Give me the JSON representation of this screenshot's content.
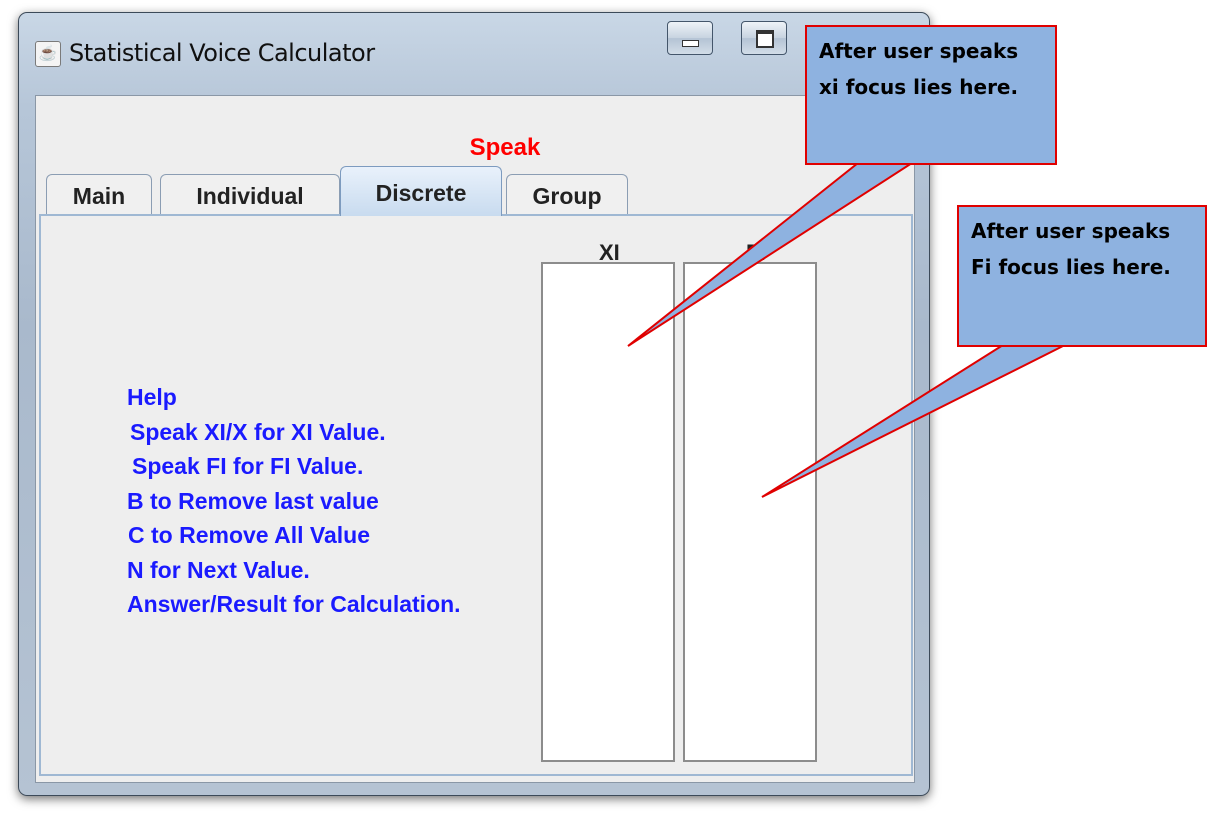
{
  "window": {
    "title": "Statistical Voice Calculator",
    "icon": "java-cup-icon"
  },
  "status_label": "Speak",
  "tabs": [
    {
      "label": "Main",
      "selected": false
    },
    {
      "label": "Individual",
      "selected": false
    },
    {
      "label": "Discrete",
      "selected": true
    },
    {
      "label": "Group",
      "selected": false
    }
  ],
  "columns": {
    "xi_header": "XI",
    "fi_header": "FI"
  },
  "help_lines": [
    "Help",
    "Speak XI/X for XI Value.",
    "Speak FI for FI Value.",
    "B to Remove last value",
    "C to Remove All Value",
    "N for Next Value.",
    "Answer/Result for Calculation."
  ],
  "callouts": {
    "xi": "After user speaks xi focus lies here.",
    "fi": "After user speaks Fi focus lies here."
  },
  "colors": {
    "status": "#ff0000",
    "help_text": "#1a1aff",
    "callout_fill": "#8eb2e0",
    "callout_border": "#e00000"
  }
}
